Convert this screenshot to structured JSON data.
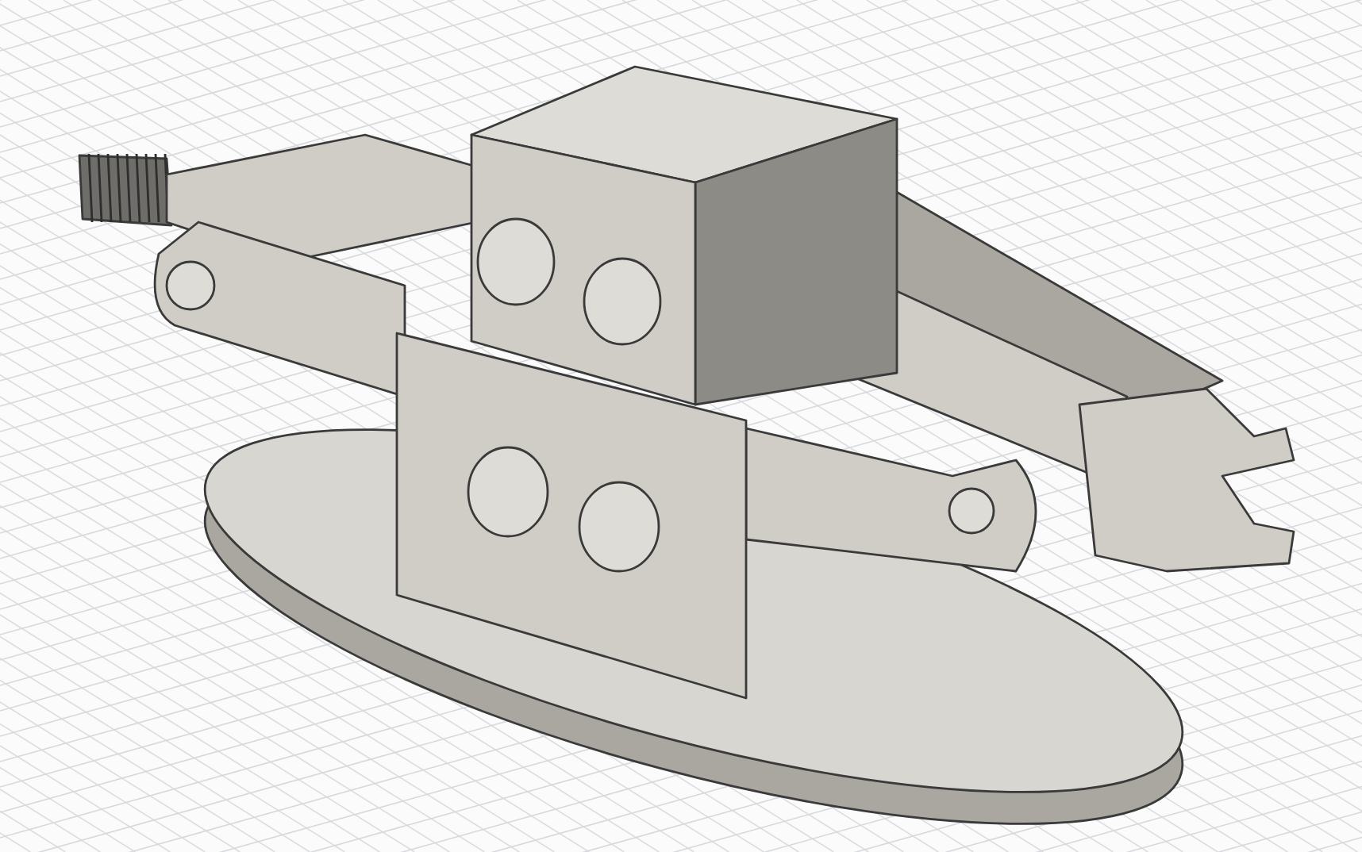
{
  "viewport": {
    "kind": "cad-model",
    "grid": true
  }
}
